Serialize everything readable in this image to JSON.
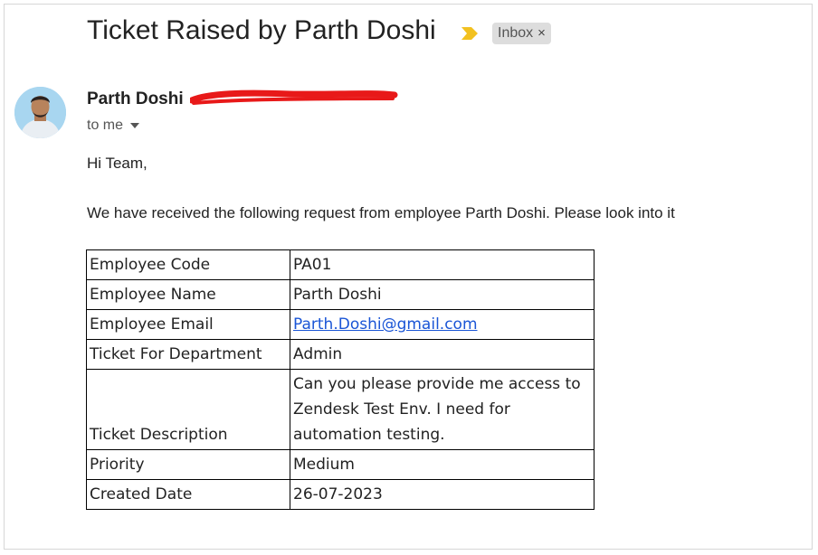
{
  "email": {
    "subject": "Ticket Raised by Parth Doshi",
    "importance_icon": "importance-marker",
    "label": "Inbox",
    "label_close": "×",
    "sender_name": "Parth Doshi",
    "recipient": "to me",
    "greeting": "Hi Team,",
    "intro": "We have received the following request from employee Parth Doshi. Please look into it"
  },
  "ticket": {
    "employee_code_label": "Employee Code",
    "employee_code": "PA01",
    "employee_name_label": "Employee Name",
    "employee_name": "Parth Doshi",
    "employee_email_label": "Employee Email",
    "employee_email": "Parth.Doshi@gmail.com",
    "department_label": "Ticket For Department",
    "department": "Admin",
    "description_label": "Ticket Description",
    "description_line1": "Can you please provide me access to",
    "description_line2": "Zendesk Test Env. I need for",
    "description_line3": "automation testing.",
    "priority_label": "Priority",
    "priority": "Medium",
    "created_label": "Created Date",
    "created": "26-07-2023"
  },
  "colors": {
    "importance": "#f2c120",
    "redaction": "#e81919",
    "link": "#1a55d6",
    "label_bg": "#dddddd"
  }
}
